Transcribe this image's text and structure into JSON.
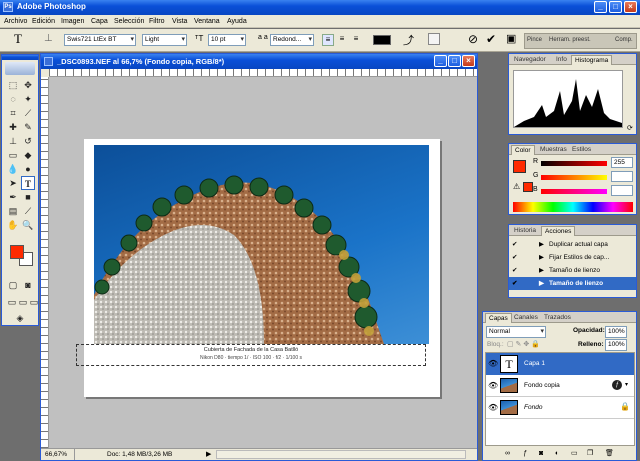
{
  "app": {
    "title": "Adobe Photoshop"
  },
  "menu": [
    "Archivo",
    "Edición",
    "Imagen",
    "Capa",
    "Selección",
    "Filtro",
    "Vista",
    "Ventana",
    "Ayuda"
  ],
  "options": {
    "tool_glyph": "T",
    "font_family": "Swis721 LtEx BT",
    "font_style": "Light",
    "font_size": "10 pt",
    "aa_glyph": "a a",
    "antialias": "Redond...",
    "color": "#000000",
    "wells": [
      "Pince",
      "Herram. preest.",
      "Comp."
    ]
  },
  "document": {
    "title": "_DSC0893.NEF al 66,7% (Fondo copia, RGB/8*)",
    "caption1": "Cubierta de Fachada de la Casa Batlló",
    "caption2": "Nikon D80 · tiempo 1/ · ISO 100 · f/2 · 1/100 s",
    "zoom": "66,67%",
    "status": "Doc: 1,48 MB/3,26 MB"
  },
  "navigator": {
    "tabs": [
      "Navegador",
      "Info",
      "Histograma"
    ]
  },
  "color_panel": {
    "tabs": [
      "Color",
      "Muestras",
      "Estilos"
    ],
    "r_label": "R",
    "g_label": "G",
    "b_label": "B",
    "r": "255",
    "g": "",
    "b": "",
    "fg": "#ff2a00"
  },
  "actions": {
    "tabs": [
      "Historia",
      "Acciones"
    ],
    "items": [
      "Duplicar actual capa",
      "Fijar Estilos de cap...",
      "Tamaño de lienzo",
      "Tamaño de lienzo"
    ]
  },
  "layers": {
    "tabs": [
      "Capas",
      "Canales",
      "Trazados"
    ],
    "blend_mode": "Normal",
    "opacity_label": "Opacidad:",
    "opacity": "100%",
    "lock_label": "Bloq.:",
    "fill_label": "Relleno:",
    "fill": "100%",
    "items": [
      {
        "name": "Capa 1"
      },
      {
        "name": "Fondo copia"
      },
      {
        "name": "Fondo"
      }
    ]
  }
}
